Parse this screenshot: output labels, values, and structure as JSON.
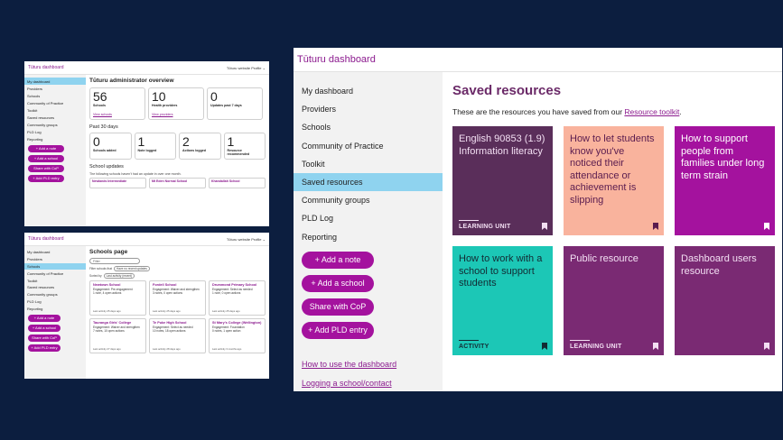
{
  "small_windows": {
    "overview": {
      "brand": "Tūturu dashboard",
      "top_right": "Tūturu website  Profile ⌄",
      "nav": [
        "My dashboard",
        "Providers",
        "Schools",
        "Community of Practice",
        "Toolkit",
        "Saved resources",
        "Community groups",
        "PLD Log",
        "Reporting"
      ],
      "active_index": 0,
      "buttons": [
        "+ Add a note",
        "+ Add a school",
        "Share with CoP",
        "+ Add PLD entry"
      ],
      "title": "Tūturu administrator overview",
      "stats": [
        {
          "num": "56",
          "label": "Schools",
          "link": "View schools"
        },
        {
          "num": "10",
          "label": "Health providers",
          "link": "View providers"
        },
        {
          "num": "0",
          "label": "Updates past 7 days",
          "link": ""
        }
      ],
      "past_title": "Past 30 days",
      "past_stats": [
        {
          "num": "0",
          "label": "Schools added"
        },
        {
          "num": "1",
          "label": "Note logged"
        },
        {
          "num": "2",
          "label": "Actions logged"
        },
        {
          "num": "1",
          "label": "Resource recommended"
        }
      ],
      "updates_title": "School updates",
      "updates_sub": "The following schools haven't had an update in over one month.",
      "update_schools": [
        "Newlands Intermediate",
        "Mt Eden Normal School",
        "Khandallah School"
      ]
    },
    "schools": {
      "brand": "Tūturu dashboard",
      "top_right": "Tūturu website  Profile ⌄",
      "nav": [
        "My dashboard",
        "Providers",
        "Schools",
        "Community of Practice",
        "Toolkit",
        "Saved resources",
        "Community groups",
        "PLD Log",
        "Reporting"
      ],
      "active_index": 2,
      "buttons": [
        "+ Add a note",
        "+ Add a school",
        "Share with CoP",
        "+ Add PLD entry"
      ],
      "title": "Schools page",
      "filter_placeholder": "Filter",
      "filter_label": "Filter schools that",
      "filter_chip": "Have no recent updates",
      "sort_label": "Sorted by",
      "sort_value": "Last activity (recent)",
      "schools": [
        {
          "name": "Newtown School",
          "info": "Engagement: Pre-engagement\n1 note, 4 open actions",
          "last": "Last activity 25 days ago"
        },
        {
          "name": "Fordell School",
          "info": "Engagement: Waiver and strengthen\n3 notes, 0 open actions",
          "last": "Last activity 25 days ago"
        },
        {
          "name": "Drummond Primary School",
          "info": "Engagement: Select as needed\n1 note, 0 open actions",
          "last": "Last activity 25 days ago"
        },
        {
          "name": "Tauranga Girls' College",
          "info": "Engagement: Waiver and strengthen\n7 notes, 10 open actions",
          "last": "Last activity 27 days ago"
        },
        {
          "name": "Te Puke High School",
          "info": "Engagement: Select as needed\n10 notes, 18 open actions",
          "last": "Last activity 28 days ago"
        },
        {
          "name": "St Mary's College (Wellington)",
          "info": "Engagement: Foundation\n0 notes, 1 open action",
          "last": "Last activity 3 months ago"
        }
      ]
    }
  },
  "main_window": {
    "brand": "Tūturu dashboard",
    "nav": [
      "My dashboard",
      "Providers",
      "Schools",
      "Community of Practice",
      "Toolkit",
      "Saved resources",
      "Community groups",
      "PLD Log",
      "Reporting"
    ],
    "active_index": 5,
    "buttons": [
      "+ Add a note",
      "+ Add a school",
      "Share with CoP",
      "+ Add PLD entry"
    ],
    "footer_links": [
      "How to use the dashboard",
      "Logging a school/contact"
    ],
    "title": "Saved resources",
    "intro_text": "These are the resources you have saved from our",
    "intro_link": "Resource toolkit",
    "intro_end": ".",
    "resources": [
      {
        "title": "English 90853 (1.9) Information literacy",
        "tag": "LEARNING UNIT",
        "bg": "#5a2e5a",
        "fg": "#f3dff3"
      },
      {
        "title": "How to let students know you've noticed their attendance or achievement is slipping",
        "tag": "",
        "bg": "#f9b39d",
        "fg": "#5a1c4f"
      },
      {
        "title": "How to support people from families under long term strain",
        "tag": "",
        "bg": "#a4129e",
        "fg": "#ffffff"
      },
      {
        "title": "How to work with a school to support students",
        "tag": "ACTIVITY",
        "bg": "#1cc7b6",
        "fg": "#132a33"
      },
      {
        "title": "Public resource",
        "tag": "LEARNING UNIT",
        "bg": "#7a2a73",
        "fg": "#f3dff3"
      },
      {
        "title": "Dashboard users resource",
        "tag": "",
        "bg": "#7a2a73",
        "fg": "#f3dff3"
      }
    ]
  }
}
